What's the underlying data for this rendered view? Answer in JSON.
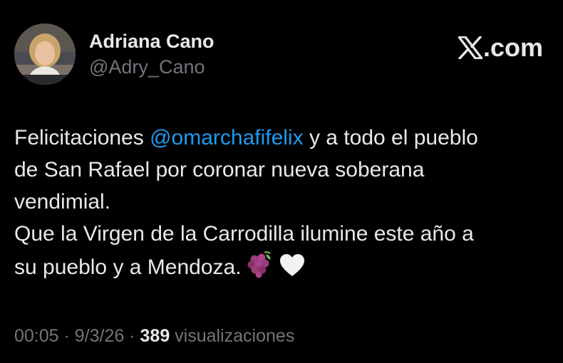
{
  "author": {
    "name": "Adriana Cano",
    "handle": "@Adry_Cano",
    "avatar_icon": "profile-photo"
  },
  "brand": {
    "icon": "x-logo-icon",
    "label": ".com"
  },
  "tweet": {
    "line1_prefix": "Felicitaciones ",
    "mention": "@omarchafifelix",
    "line1_suffix": " y a todo el pueblo",
    "line2": "de San Rafael por coronar nueva soberana",
    "line3": "vendimial.",
    "line4": "Que la Virgen de la Carrodilla ilumine este año a",
    "line5": "su pueblo y a Mendoza.",
    "emojis": [
      "grapes-emoji",
      "white-heart-emoji"
    ]
  },
  "meta": {
    "time": "00:05",
    "separator1": " · ",
    "date": "9/3/26",
    "separator2": " · ",
    "views_count": "389",
    "views_label": " visualizaciones"
  },
  "colors": {
    "background": "#000000",
    "text": "#e7e9ea",
    "secondary": "#71767b",
    "link": "#1d9bf0"
  }
}
